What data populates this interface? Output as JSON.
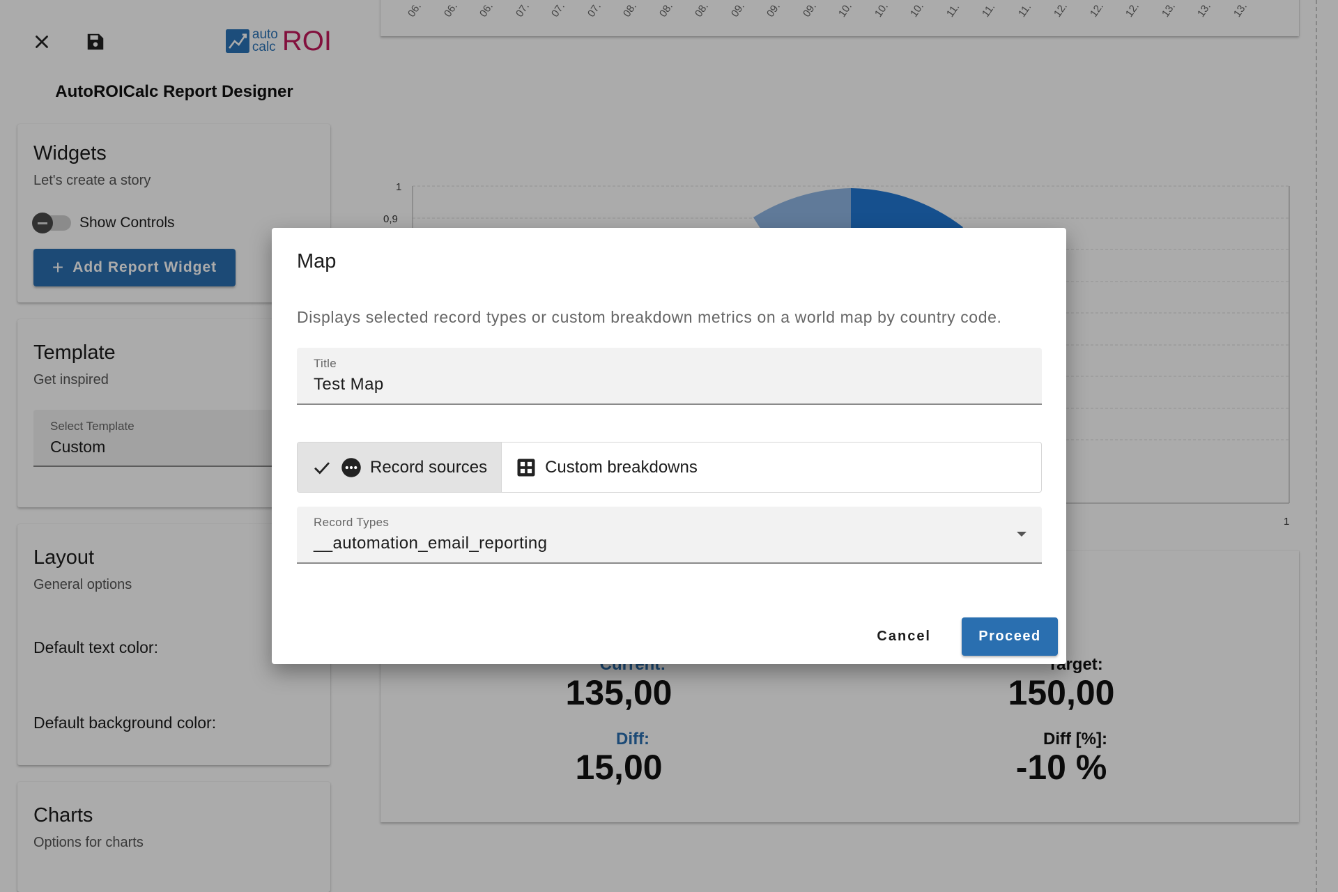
{
  "toolbar": {
    "close_icon": "close-icon",
    "save_icon": "save-icon"
  },
  "logo": {
    "word1": "auto",
    "word2": "calc",
    "word3": "ROI"
  },
  "app_title": "AutoROICalc Report Designer",
  "widgets": {
    "title": "Widgets",
    "subtitle": "Let's create a story",
    "toggle_label": "Show Controls",
    "add_button": "Add Report Widget"
  },
  "template": {
    "title": "Template",
    "subtitle": "Get inspired",
    "select_label": "Select Template",
    "select_value": "Custom"
  },
  "layout": {
    "title": "Layout",
    "subtitle": "General options",
    "text_color_label": "Default text color:",
    "bg_color_label": "Default background color:"
  },
  "charts": {
    "title": "Charts",
    "subtitle": "Options for charts"
  },
  "canvas": {
    "date_ticks": [
      "06.",
      "06.",
      "06.",
      "07.",
      "07.",
      "07.",
      "08.",
      "08.",
      "08.",
      "09.",
      "09.",
      "09.",
      "10.",
      "10.",
      "10.",
      "11.",
      "11.",
      "11.",
      "12.",
      "12.",
      "12.",
      "13.",
      "13.",
      "13."
    ],
    "y_tick_top": "1",
    "y_tick_2": "0,9",
    "x_tick_right": "1",
    "kpi": {
      "current_label": "Current:",
      "current_value": "135,00",
      "target_label": "Target:",
      "target_value": "150,00",
      "diff_label": "Diff:",
      "diff_value": "15,00",
      "diff_pct_label": "Diff [%]:",
      "diff_pct_value": "-10 %"
    }
  },
  "dialog": {
    "title": "Map",
    "description": "Displays selected record types or custom breakdown metrics on a world map by country code.",
    "title_field": {
      "label": "Title",
      "value": "Test Map"
    },
    "segments": [
      {
        "label": "Record sources",
        "selected": true
      },
      {
        "label": "Custom breakdowns",
        "selected": false
      }
    ],
    "record_types": {
      "label": "Record Types",
      "value": "__automation_email_reporting"
    },
    "cancel": "Cancel",
    "proceed": "Proceed"
  },
  "colors": {
    "primary": "#2a6fb0",
    "logo_roi": "#c2185b",
    "scrim": "rgba(0,0,0,0.33)"
  }
}
